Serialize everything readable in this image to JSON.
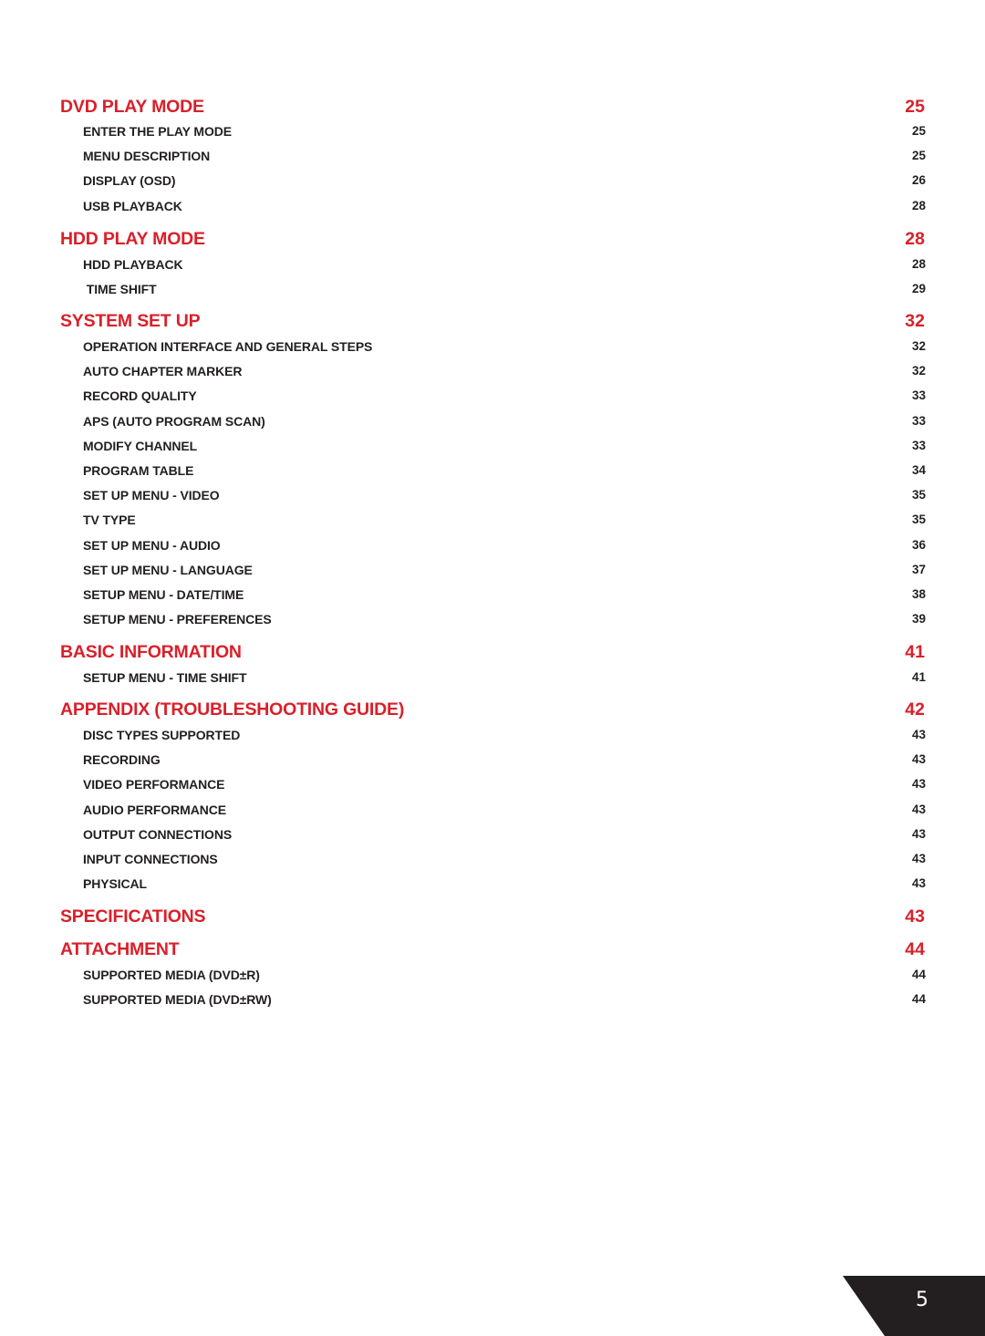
{
  "toc": {
    "sections": [
      {
        "title": "DVD PLAY MODE",
        "page": "25",
        "items": [
          {
            "title": "ENTER THE PLAY MODE",
            "page": "25"
          },
          {
            "title": "MENU DESCRIPTION",
            "page": "25"
          },
          {
            "title": "DISPLAY (OSD)",
            "page": "26"
          },
          {
            "title": "USB PLAYBACK",
            "page": "28"
          }
        ]
      },
      {
        "title": "HDD PLAY MODE",
        "page": "28",
        "items": [
          {
            "title": "HDD PLAYBACK",
            "page": "28"
          },
          {
            "title": " TIME SHIFT",
            "page": "29"
          }
        ]
      },
      {
        "title": "SYSTEM SET UP",
        "page": "32",
        "items": [
          {
            "title": "OPERATION INTERFACE AND GENERAL STEPS",
            "page": "32"
          },
          {
            "title": "AUTO CHAPTER MARKER",
            "page": "32"
          },
          {
            "title": "RECORD QUALITY",
            "page": "33"
          },
          {
            "title": "APS (AUTO PROGRAM SCAN)",
            "page": "33"
          },
          {
            "title": "MODIFY CHANNEL",
            "page": "33"
          },
          {
            "title": "PROGRAM TABLE",
            "page": "34"
          },
          {
            "title": "SET UP MENU - VIDEO",
            "page": "35"
          },
          {
            "title": "TV TYPE",
            "page": "35"
          },
          {
            "title": "SET UP MENU - AUDIO",
            "page": "36"
          },
          {
            "title": "SET UP MENU - LANGUAGE",
            "page": "37"
          },
          {
            "title": "SETUP MENU - DATE/TIME",
            "page": "38"
          },
          {
            "title": "SETUP MENU - PREFERENCES",
            "page": "39"
          }
        ]
      },
      {
        "title": "BASIC INFORMATION",
        "page": "41",
        "items": [
          {
            "title": "SETUP MENU - TIME SHIFT",
            "page": "41"
          }
        ]
      },
      {
        "title": "APPENDIX (TROUBLESHOOTING GUIDE)",
        "page": "42",
        "items": [
          {
            "title": "DISC TYPES SUPPORTED",
            "page": "43"
          },
          {
            "title": "RECORDING",
            "page": "43"
          },
          {
            "title": "VIDEO PERFORMANCE",
            "page": "43"
          },
          {
            "title": "AUDIO PERFORMANCE",
            "page": "43"
          },
          {
            "title": "OUTPUT CONNECTIONS",
            "page": "43"
          },
          {
            "title": "INPUT CONNECTIONS",
            "page": "43"
          },
          {
            "title": "PHYSICAL",
            "page": "43"
          }
        ]
      },
      {
        "title": "SPECIFICATIONS",
        "page": "43",
        "items": []
      },
      {
        "title": "ATTACHMENT",
        "page": "44",
        "items": [
          {
            "title": "SUPPORTED MEDIA (DVD±R)",
            "page": "44"
          },
          {
            "title": "SUPPORTED MEDIA (DVD±RW)",
            "page": "44"
          }
        ]
      }
    ]
  },
  "footer": {
    "page_number": "5"
  },
  "colors": {
    "accent": "#d9202a",
    "text": "#231f20",
    "tab": "#231f20"
  }
}
